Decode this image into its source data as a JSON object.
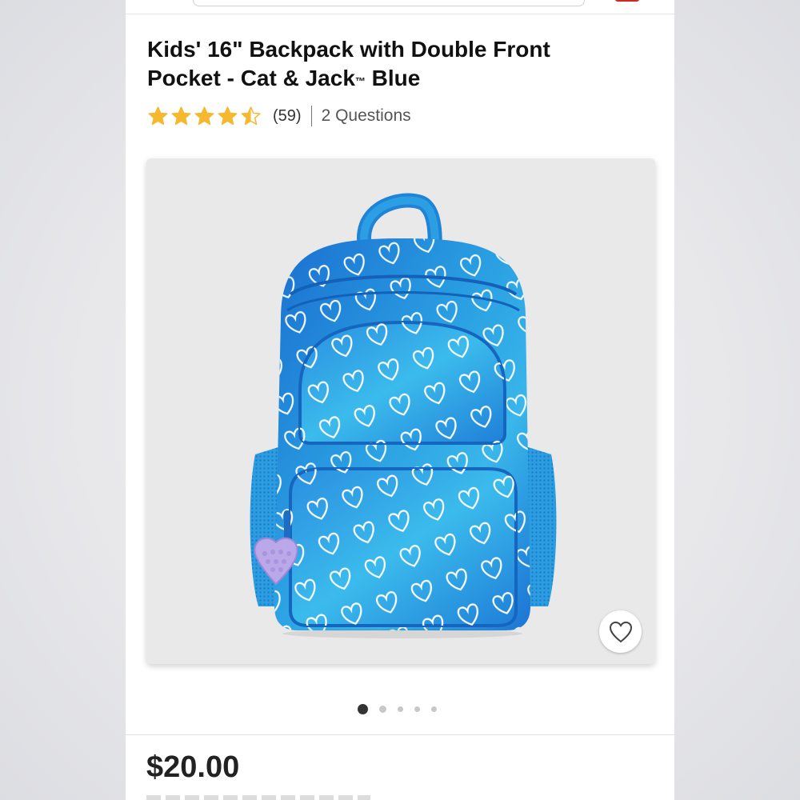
{
  "product": {
    "title_line1": "Kids' 16\" Backpack with Double Front",
    "title_line2_main": "Pocket - Cat & Jack",
    "title_trademark": "™",
    "title_line2_end": " Blue",
    "rating": 4.5,
    "rating_max": 5,
    "review_count": "(59)",
    "questions_label": "2 Questions",
    "price": "$20.00"
  },
  "gallery": {
    "total_images": 5,
    "active_index": 0,
    "favorite_icon": "heart-outline-icon"
  },
  "colors": {
    "star_fill": "#f5b82e",
    "star_empty": "#c9c9c9",
    "bag_blue": "#1d88d6",
    "bag_light": "#34b1e8",
    "charm_purple": "#b9a7e6"
  }
}
